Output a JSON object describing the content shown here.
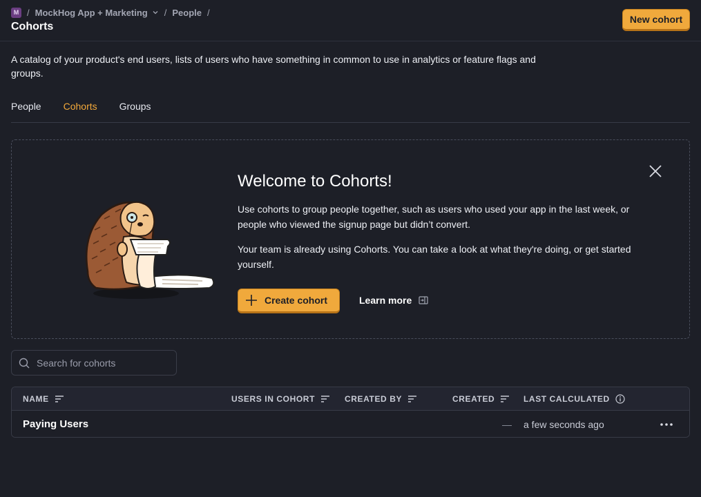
{
  "header": {
    "org_badge": "M",
    "project_name": "MockHog App + Marketing",
    "crumb_people": "People",
    "separator": "/",
    "page_title": "Cohorts",
    "new_cohort_label": "New cohort"
  },
  "description": "A catalog of your product's end users, lists of users who have something in common to use in analytics or feature flags and groups.",
  "tabs": [
    {
      "label": "People",
      "active": false
    },
    {
      "label": "Cohorts",
      "active": true
    },
    {
      "label": "Groups",
      "active": false
    }
  ],
  "welcome": {
    "title": "Welcome to Cohorts!",
    "paragraph1": "Use cohorts to group people together, such as users who used your app in the last week, or people who viewed the signup page but didn’t convert.",
    "paragraph2": "Your team is already using Cohorts. You can take a look at what they're doing, or get started yourself.",
    "create_label": "Create cohort",
    "learn_more_label": "Learn more"
  },
  "search": {
    "placeholder": "Search for cohorts"
  },
  "table": {
    "columns": [
      "NAME",
      "USERS IN COHORT",
      "CREATED BY",
      "CREATED",
      "LAST CALCULATED"
    ],
    "rows": [
      {
        "name": "Paying Users",
        "users": "",
        "created_by": "",
        "created": "—",
        "last_calculated": "a few seconds ago"
      }
    ]
  },
  "colors": {
    "background": "#1d1f27",
    "accent": "#f0a93c",
    "active_tab": "#f4a93a"
  }
}
